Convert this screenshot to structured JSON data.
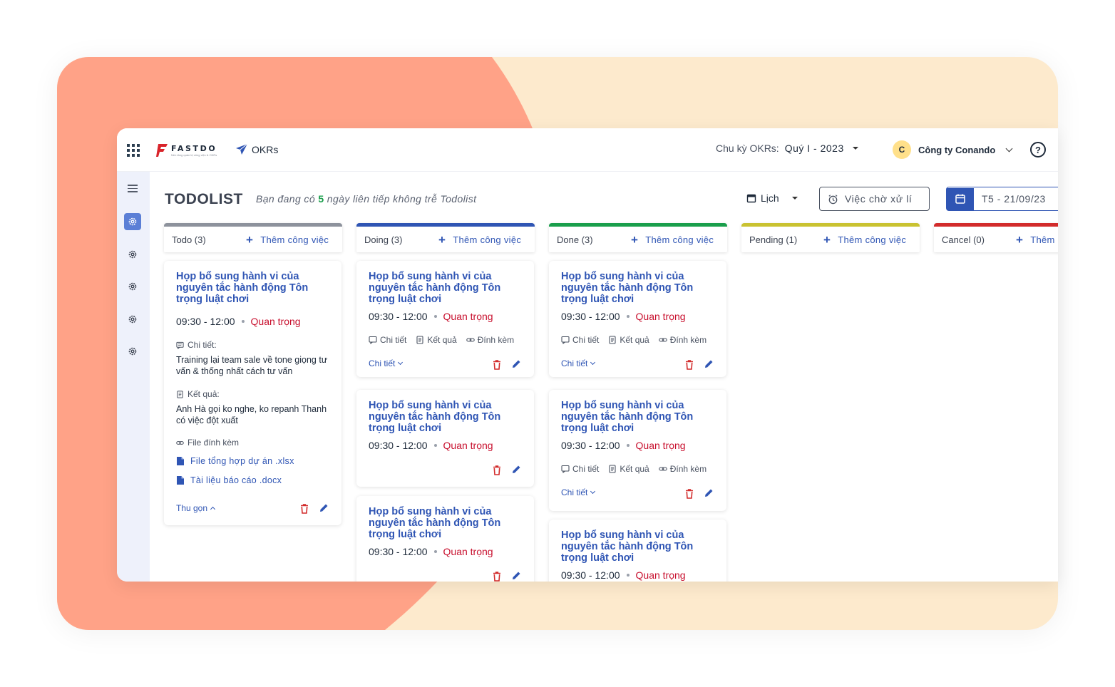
{
  "app": {
    "brand": "FASTDO",
    "brand_tagline": "Nền tảng quản trị công việc & OKRs",
    "module": "OKRs",
    "cycle_label": "Chu kỳ OKRs:",
    "cycle_value": "Quý I - 2023",
    "company_initial": "C",
    "company_name": "Công ty Conando",
    "help": "?"
  },
  "page": {
    "title": "TODOLIST",
    "streak_prefix": "Bạn đang có ",
    "streak_count": "5",
    "streak_suffix": " ngày liên tiếp không trễ Todolist",
    "view_select": "Lịch",
    "pending_button": "Việc chờ xử lí",
    "date": "T5 - 21/09/23"
  },
  "columns": [
    {
      "name": "Todo (3)",
      "add_label": "Thêm công việc",
      "color": "#8d929c"
    },
    {
      "name": "Doing (3)",
      "add_label": "Thêm công việc",
      "color": "#2f55b4"
    },
    {
      "name": "Done (3)",
      "add_label": "Thêm công việc",
      "color": "#1a9e4b"
    },
    {
      "name": "Pending (1)",
      "add_label": "Thêm công việc",
      "color": "#c9c231"
    },
    {
      "name": "Cancel (0)",
      "add_label": "Thêm",
      "color": "#d22b2b"
    }
  ],
  "card_common": {
    "title": "Họp bổ sung hành vi của nguyên tắc hành động Tôn trọng luật chơi",
    "time": "09:30 - 12:00",
    "priority": "Quan trọng",
    "meta_detail": "Chi tiết",
    "meta_result": "Kết quả",
    "meta_attach": "Đính kèm",
    "detail_link": "Chi tiết"
  },
  "expanded_card": {
    "detail_label": "Chi tiết:",
    "detail_text": "Training lại team sale về tone giọng tư vấn & thống nhất cách tư vấn",
    "result_label": "Kết quả:",
    "result_text": "Anh Hà gọi ko nghe, ko repanh Thanh có việc đột xuất",
    "files_label": "File đính kèm",
    "files": [
      "File tổng hợp dự án .xlsx",
      "Tài liệu báo cáo .docx"
    ],
    "collapse": "Thu gọn"
  },
  "colors": {
    "accent": "#2f55b4",
    "priority": "#c8102e",
    "streak": "#1a9e4b",
    "bg_coral": "#ffa287",
    "bg_cream": "#fdeacd",
    "sidebar": "#eef1fb"
  }
}
